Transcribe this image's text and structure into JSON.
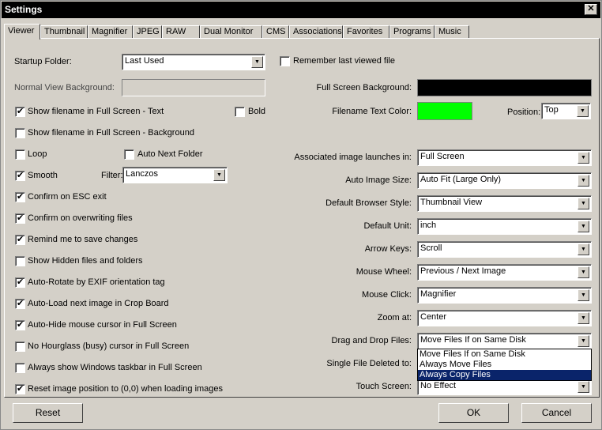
{
  "window": {
    "title": "Settings",
    "close": "✕"
  },
  "tabs": [
    "Viewer",
    "Thumbnail",
    "Magnifier",
    "JPEG",
    "RAW",
    "Dual Monitor",
    "CMS",
    "Associations",
    "Favorites",
    "Programs",
    "Music"
  ],
  "left": {
    "startup_label": "Startup Folder:",
    "startup_value": "Last Used",
    "normal_bg_label": "Normal View Background:",
    "bold_label": "Bold",
    "auto_next_label": "Auto Next Folder",
    "filter_label": "Filter:",
    "filter_value": "Lanczos",
    "checkboxes": [
      {
        "label": "Show filename in Full Screen - Text",
        "checked": true
      },
      {
        "label": "Show filename in Full Screen - Background",
        "checked": false
      },
      {
        "label": "Loop",
        "checked": false
      },
      {
        "label": "Smooth",
        "checked": true
      },
      {
        "label": "Confirm on ESC exit",
        "checked": true
      },
      {
        "label": "Confirm on overwriting files",
        "checked": true
      },
      {
        "label": "Remind me to save changes",
        "checked": true
      },
      {
        "label": "Show Hidden files and folders",
        "checked": false
      },
      {
        "label": "Auto-Rotate by EXIF orientation tag",
        "checked": true
      },
      {
        "label": "Auto-Load next image in Crop Board",
        "checked": true
      },
      {
        "label": "Auto-Hide mouse cursor in Full Screen",
        "checked": true
      },
      {
        "label": "No Hourglass (busy) cursor in Full Screen",
        "checked": false
      },
      {
        "label": "Always show Windows taskbar in Full Screen",
        "checked": false
      },
      {
        "label": "Reset image position to (0,0) when loading images",
        "checked": true
      }
    ]
  },
  "right": {
    "remember_label": "Remember last viewed file",
    "fs_bg_label": "Full Screen Background:",
    "fs_bg_color": "#000000",
    "fn_color_label": "Filename Text Color:",
    "fn_color": "#00ff00",
    "position_label": "Position:",
    "position_value": "Top",
    "combos": [
      {
        "label": "Associated image launches in:",
        "value": "Full Screen"
      },
      {
        "label": "Auto Image Size:",
        "value": "Auto Fit (Large Only)"
      },
      {
        "label": "Default Browser Style:",
        "value": "Thumbnail View"
      },
      {
        "label": "Default Unit:",
        "value": "inch"
      },
      {
        "label": "Arrow Keys:",
        "value": "Scroll"
      },
      {
        "label": "Mouse Wheel:",
        "value": "Previous / Next Image"
      },
      {
        "label": "Mouse Click:",
        "value": "Magnifier"
      },
      {
        "label": "Zoom at:",
        "value": "Center"
      },
      {
        "label": "Drag and Drop Files:",
        "value": "Move Files If on Same Disk"
      },
      {
        "label": "Single File Deleted to:",
        "value": ""
      },
      {
        "label": "Touch Screen:",
        "value": "No Effect"
      }
    ],
    "dropdown_options": [
      "Move Files If on Same Disk",
      "Always Move Files",
      "Always Copy Files"
    ],
    "dropdown_selected": 2
  },
  "buttons": {
    "reset": "Reset",
    "ok": "OK",
    "cancel": "Cancel"
  }
}
